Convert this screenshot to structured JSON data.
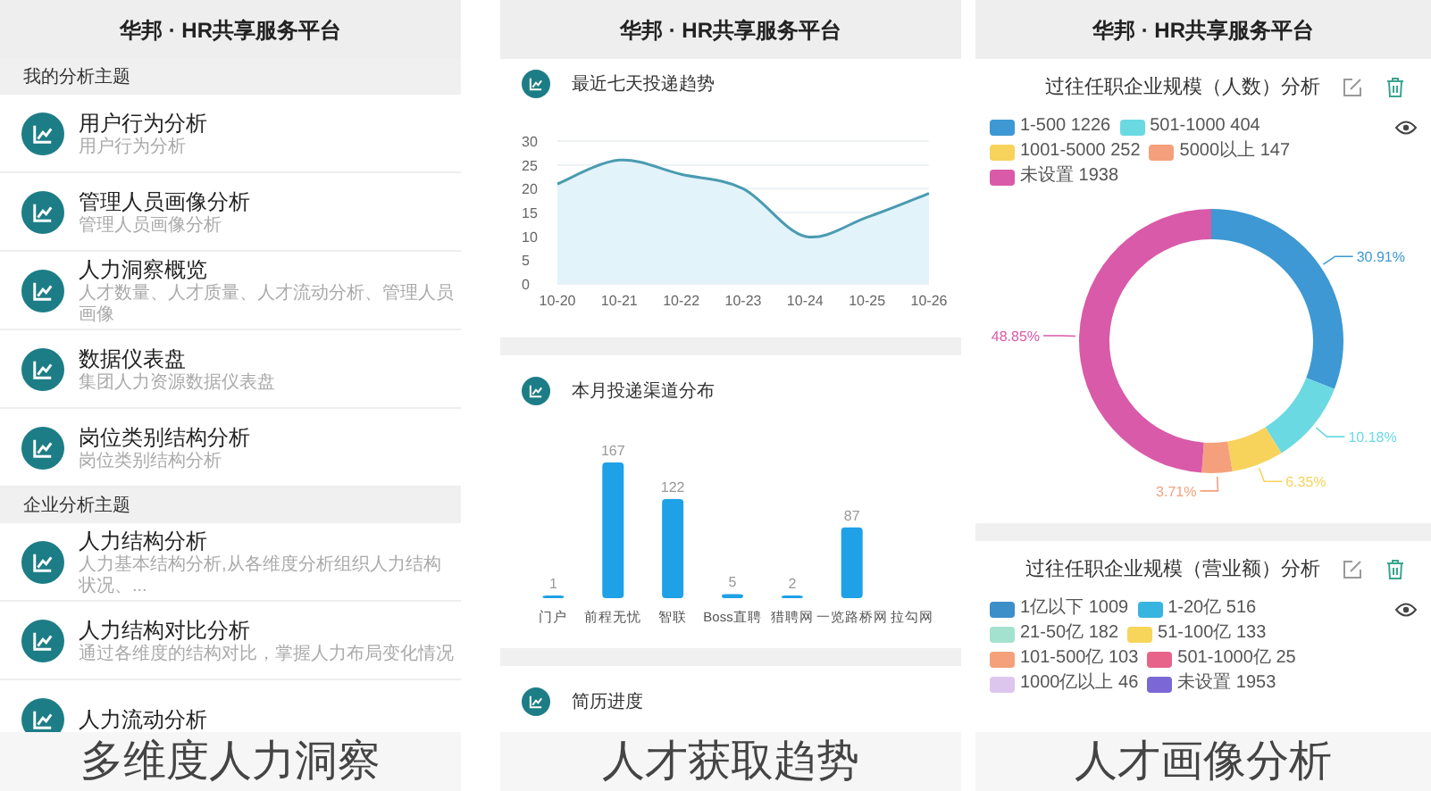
{
  "panels": [
    {
      "kind": "topics",
      "header": "华邦 · HR共享服务平台",
      "caption": "多维度人力洞察",
      "groups": [
        {
          "title": "我的分析主题",
          "items": [
            {
              "title": "用户行为分析",
              "subtitle": "用户行为分析"
            },
            {
              "title": "管理人员画像分析",
              "subtitle": "管理人员画像分析"
            },
            {
              "title": "人力洞察概览",
              "subtitle": "人才数量、人才质量、人才流动分析、管理人员画像"
            },
            {
              "title": "数据仪表盘",
              "subtitle": "集团人力资源数据仪表盘"
            },
            {
              "title": "岗位类别结构分析",
              "subtitle": "岗位类别结构分析"
            }
          ]
        },
        {
          "title": "企业分析主题",
          "items": [
            {
              "title": "人力结构分析",
              "subtitle": "人力基本结构分析,从各维度分析组织人力结构状况、..."
            },
            {
              "title": "人力结构对比分析",
              "subtitle": "通过各维度的结构对比，掌握人力布局变化情况"
            },
            {
              "title": "人力流动分析"
            }
          ]
        }
      ]
    },
    {
      "kind": "charts",
      "header": "华邦 · HR共享服务平台",
      "caption": "人才获取趋势",
      "sections": [
        {
          "title": "最近七天投递趋势",
          "chart_data": {
            "type": "area",
            "categories": [
              "10-20",
              "10-21",
              "10-22",
              "10-23",
              "10-24",
              "10-25",
              "10-26"
            ],
            "series": [
              {
                "color": "#4a9bb0",
                "values": [
                  21,
                  26,
                  23,
                  20,
                  10,
                  14,
                  19
                ]
              }
            ],
            "ylim": [
              0,
              30
            ],
            "yticks": [
              0,
              5,
              10,
              15,
              20,
              25,
              30
            ],
            "grid": true
          }
        },
        {
          "title": "本月投递渠道分布",
          "chart_data": {
            "type": "bar",
            "categories": [
              "门户",
              "前程无忧",
              "智联",
              "Boss直聘",
              "猎聘网",
              "一览路桥网",
              "拉勾网"
            ],
            "series": [
              {
                "color": "#1ea1e6",
                "values": [
                  1,
                  167,
                  122,
                  5,
                  2,
                  87,
                  null
                ]
              }
            ],
            "data_labels": true
          }
        },
        {
          "title": "简历进度"
        }
      ]
    },
    {
      "kind": "portrait",
      "header": "华邦 · HR共享服务平台",
      "caption": "人才画像分析",
      "cards": [
        {
          "title": "过往任职企业规模（人数）分析",
          "legend": [
            {
              "label": "1-500 1226",
              "color": "#3d98d3"
            },
            {
              "label": "501-1000 404",
              "color": "#6ad9e2"
            },
            {
              "label": "1001-5000 252",
              "color": "#f7d35c"
            },
            {
              "label": "5000以上 147",
              "color": "#f5a07c"
            },
            {
              "label": "未设置 1938",
              "color": "#d95aa8"
            }
          ],
          "chart_data": {
            "type": "donut",
            "values": [
              30.91,
              10.18,
              6.35,
              3.71,
              48.85
            ],
            "value_labels": [
              "30.91%",
              "10.18%",
              "6.35%",
              "3.71%",
              "48.85%"
            ]
          }
        },
        {
          "title": "过往任职企业规模（营业额）分析",
          "legend": [
            {
              "label": "1亿以下 1009",
              "color": "#3d8fc9"
            },
            {
              "label": "1-20亿 516",
              "color": "#36b5e0"
            },
            {
              "label": "21-50亿 182",
              "color": "#a3e2cf"
            },
            {
              "label": "51-100亿 133",
              "color": "#f7d55a"
            },
            {
              "label": "101-500亿 103",
              "color": "#f4a07a"
            },
            {
              "label": "501-1000亿 25",
              "color": "#e8638a"
            },
            {
              "label": "1000亿以上 46",
              "color": "#dcc6ee"
            },
            {
              "label": "未设置 1953",
              "color": "#7b68d6"
            }
          ]
        }
      ]
    }
  ]
}
